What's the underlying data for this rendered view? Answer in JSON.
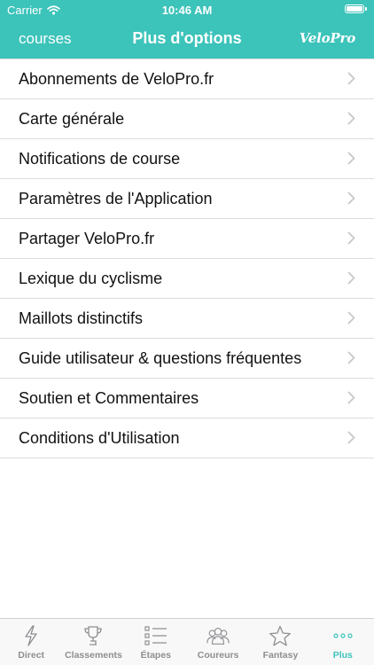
{
  "status_bar": {
    "carrier": "Carrier",
    "time": "10:46 AM"
  },
  "nav": {
    "back_label": "courses",
    "title": "Plus d'options",
    "logo_text": "VeloPro"
  },
  "menu": {
    "items": [
      {
        "label": "Abonnements de VeloPro.fr"
      },
      {
        "label": "Carte générale"
      },
      {
        "label": "Notifications de course"
      },
      {
        "label": "Paramètres de l'Application"
      },
      {
        "label": "Partager VeloPro.fr"
      },
      {
        "label": "Lexique du cyclisme"
      },
      {
        "label": "Maillots distinctifs"
      },
      {
        "label": "Guide utilisateur & questions fréquentes"
      },
      {
        "label": "Soutien et Commentaires"
      },
      {
        "label": "Conditions d'Utilisation"
      }
    ]
  },
  "tab_bar": {
    "tabs": [
      {
        "label": "Direct",
        "icon": "lightning-icon",
        "active": false
      },
      {
        "label": "Classements",
        "icon": "trophy-icon",
        "active": false
      },
      {
        "label": "Étapes",
        "icon": "list-icon",
        "active": false
      },
      {
        "label": "Coureurs",
        "icon": "riders-icon",
        "active": false
      },
      {
        "label": "Fantasy",
        "icon": "star-icon",
        "active": false
      },
      {
        "label": "Plus",
        "icon": "more-icon",
        "active": true
      }
    ]
  },
  "colors": {
    "accent": "#3cc3ba",
    "inactive": "#8e8e93",
    "separator": "#dcdcdc"
  }
}
